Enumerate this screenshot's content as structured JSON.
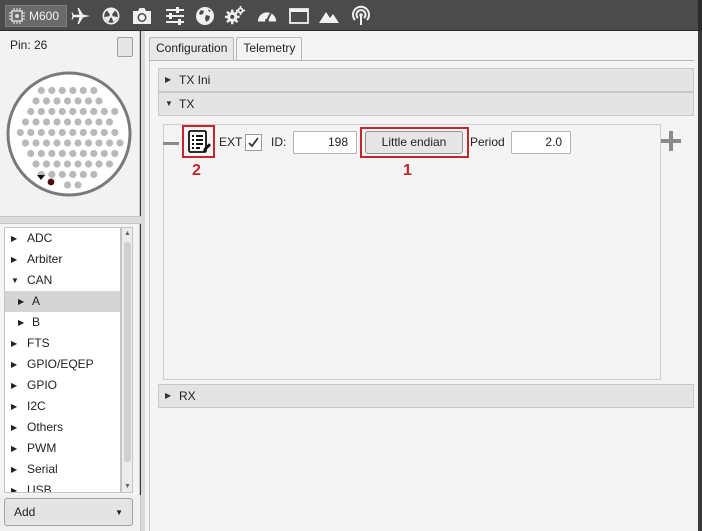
{
  "toolbar": {
    "device_name": "M600",
    "icons": [
      "chip-icon",
      "airplane-icon",
      "radiation-icon",
      "camera-icon",
      "sliders-icon",
      "globe-icon",
      "gears-icon",
      "gauge-icon",
      "window-icon",
      "mountain-icon",
      "signal-icon"
    ]
  },
  "pin_panel": {
    "pin_label": "Pin: 26"
  },
  "tree": {
    "items": [
      {
        "label": "ADC",
        "expanded": false,
        "level": 0
      },
      {
        "label": "Arbiter",
        "expanded": false,
        "level": 0
      },
      {
        "label": "CAN",
        "expanded": true,
        "level": 0
      },
      {
        "label": "A",
        "expanded": false,
        "level": 1,
        "selected": true
      },
      {
        "label": "B",
        "expanded": false,
        "level": 1
      },
      {
        "label": "FTS",
        "expanded": false,
        "level": 0
      },
      {
        "label": "GPIO/EQEP",
        "expanded": false,
        "level": 0
      },
      {
        "label": "GPIO",
        "expanded": false,
        "level": 0
      },
      {
        "label": "I2C",
        "expanded": false,
        "level": 0
      },
      {
        "label": "Others",
        "expanded": false,
        "level": 0
      },
      {
        "label": "PWM",
        "expanded": false,
        "level": 0
      },
      {
        "label": "Serial",
        "expanded": false,
        "level": 0
      },
      {
        "label": "USB",
        "expanded": false,
        "level": 0
      }
    ]
  },
  "add_button": {
    "label": "Add"
  },
  "tabs": [
    {
      "label": "Configuration",
      "active": false
    },
    {
      "label": "Telemetry",
      "active": true
    }
  ],
  "sections": {
    "tx_ini": "TX Ini",
    "tx": "TX",
    "rx": "RX"
  },
  "tx_row": {
    "ext_label": "EXT",
    "ext_checked": true,
    "id_label": "ID:",
    "id_value": "198",
    "endian_button": "Little endian",
    "period_label": "Period",
    "period_value": "2.0"
  },
  "annotations": {
    "endian_marker": "1",
    "list_marker": "2"
  },
  "colors": {
    "highlight": "#c1272d",
    "toolbar_bg": "#4b4b4b"
  }
}
